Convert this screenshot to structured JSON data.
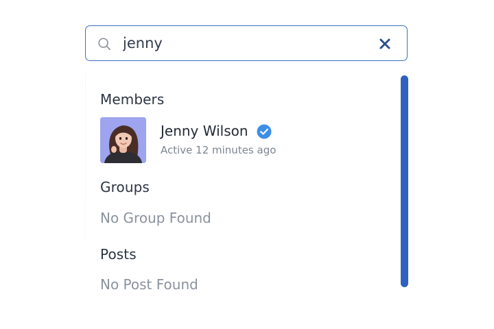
{
  "search": {
    "value": "jenny",
    "icon": "search-icon",
    "clear_icon": "close-icon"
  },
  "sections": {
    "members": {
      "title": "Members",
      "items": [
        {
          "name": "Jenny Wilson",
          "status": "Active 12 minutes ago",
          "verified_icon": "verified-badge-icon"
        }
      ]
    },
    "groups": {
      "title": "Groups",
      "empty": "No Group Found"
    },
    "posts": {
      "title": "Posts",
      "empty": "No Post Found"
    }
  },
  "colors": {
    "accent": "#3b6fc4",
    "scrollbar": "#2f62bf",
    "verified": "#3d8fe6",
    "muted_text": "#8a929e",
    "avatar_bg": "#9ea4ee"
  }
}
